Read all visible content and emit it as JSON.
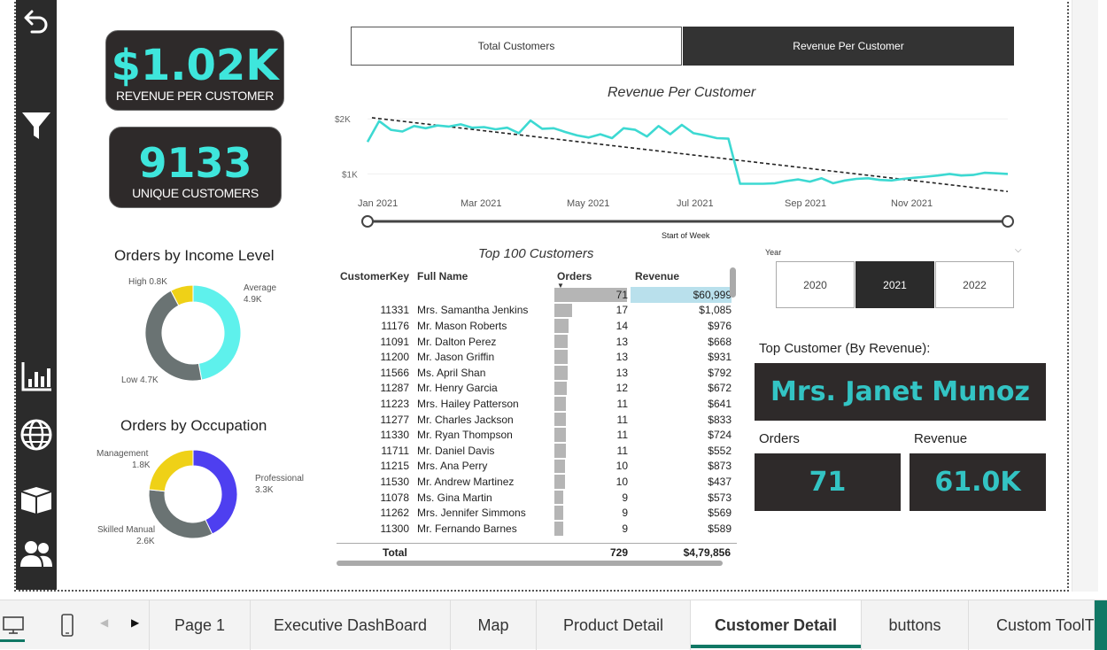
{
  "kpis": {
    "revenue_value": "$1.02K",
    "revenue_label": "REVENUE PER CUSTOMER",
    "customers_value": "9133",
    "customers_label": "UNIQUE CUSTOMERS"
  },
  "donut_income": {
    "title": "Orders by Income Level",
    "slices": [
      {
        "label": "Average",
        "value_label": "4.9K",
        "value": 4.9,
        "color": "#5ef1ec"
      },
      {
        "label": "Low",
        "value_label": "4.7K",
        "value": 4.7,
        "color": "#6a7373"
      },
      {
        "label": "High",
        "value_label": "0.8K",
        "value": 0.8,
        "color": "#efd117"
      }
    ],
    "label_high": "High 0.8K",
    "label_avg_name": "Average",
    "label_avg_val": "4.9K",
    "label_low": "Low 4.7K"
  },
  "donut_occupation": {
    "title": "Orders by Occupation",
    "slices": [
      {
        "label": "Professional",
        "value_label": "3.3K",
        "value": 3.3,
        "color": "#4e3ff0"
      },
      {
        "label": "Skilled Manual",
        "value_label": "2.6K",
        "value": 2.6,
        "color": "#6a7373"
      },
      {
        "label": "Management",
        "value_label": "1.8K",
        "value": 1.8,
        "color": "#efd117"
      }
    ],
    "label_mgmt_name": "Management",
    "label_mgmt_val": "1.8K",
    "label_prof_name": "Professional",
    "label_prof_val": "3.3K",
    "label_skill_name": "Skilled Manual",
    "label_skill_val": "2.6K"
  },
  "toggle": {
    "total_customers": "Total Customers",
    "revenue_per_customer": "Revenue Per Customer"
  },
  "chart_data": {
    "type": "line",
    "title": "Revenue Per Customer",
    "xlabel": "Start of Week",
    "ylabel": "",
    "y_ticks": [
      "$1K",
      "$2K"
    ],
    "x_ticks": [
      "Jan 2021",
      "Mar 2021",
      "May 2021",
      "Jul 2021",
      "Sep 2021",
      "Nov 2021"
    ],
    "ylim": [
      700,
      2100
    ],
    "series": [
      {
        "values": [
          1580,
          1960,
          1800,
          1770,
          1870,
          1830,
          1880,
          1860,
          1900,
          1840,
          1850,
          1810,
          1840,
          1740,
          1970,
          1820,
          1830,
          1760,
          1700,
          1660,
          1720,
          1650,
          1830,
          1800,
          1680,
          1870,
          1720,
          1890,
          1740,
          1700,
          1650,
          1640,
          820,
          820,
          820,
          830,
          870,
          900,
          860,
          920,
          830,
          880,
          910,
          920,
          890,
          880,
          910,
          930,
          950,
          970,
          1000,
          970,
          980,
          1020,
          1010,
          1000
        ]
      }
    ],
    "trendline": [
      2020,
      680
    ],
    "color": "#3dd9d2"
  },
  "table": {
    "title": "Top 100 Customers",
    "headers": [
      "CustomerKey",
      "Full Name",
      "Orders",
      "Revenue"
    ],
    "top_row": {
      "key": "",
      "name": "",
      "orders": "71",
      "revenue": "$60,999"
    },
    "rows": [
      {
        "key": "11331",
        "name": "Mrs. Samantha Jenkins",
        "orders": "17",
        "revenue": "$1,085"
      },
      {
        "key": "11176",
        "name": "Mr. Mason Roberts",
        "orders": "14",
        "revenue": "$976"
      },
      {
        "key": "11091",
        "name": "Mr. Dalton Perez",
        "orders": "13",
        "revenue": "$668"
      },
      {
        "key": "11200",
        "name": "Mr. Jason Griffin",
        "orders": "13",
        "revenue": "$931"
      },
      {
        "key": "11566",
        "name": "Ms. April Shan",
        "orders": "13",
        "revenue": "$792"
      },
      {
        "key": "11287",
        "name": "Mr. Henry Garcia",
        "orders": "12",
        "revenue": "$672"
      },
      {
        "key": "11223",
        "name": "Mrs. Hailey Patterson",
        "orders": "11",
        "revenue": "$641"
      },
      {
        "key": "11277",
        "name": "Mr. Charles Jackson",
        "orders": "11",
        "revenue": "$833"
      },
      {
        "key": "11330",
        "name": "Mr. Ryan Thompson",
        "orders": "11",
        "revenue": "$724"
      },
      {
        "key": "11711",
        "name": "Mr. Daniel Davis",
        "orders": "11",
        "revenue": "$552"
      },
      {
        "key": "11215",
        "name": "Mrs. Ana Perry",
        "orders": "10",
        "revenue": "$873"
      },
      {
        "key": "11530",
        "name": "Mr. Andrew Martinez",
        "orders": "10",
        "revenue": "$437"
      },
      {
        "key": "11078",
        "name": "Ms. Gina Martin",
        "orders": "9",
        "revenue": "$573"
      },
      {
        "key": "11262",
        "name": "Mrs. Jennifer Simmons",
        "orders": "9",
        "revenue": "$569"
      },
      {
        "key": "11300",
        "name": "Mr. Fernando Barnes",
        "orders": "9",
        "revenue": "$589"
      }
    ],
    "total_label": "Total",
    "total_orders": "729",
    "total_revenue": "$4,79,856"
  },
  "year_slicer": {
    "label": "Year",
    "options": [
      "2020",
      "2021",
      "2022"
    ],
    "selected": "2021"
  },
  "top_customer": {
    "label": "Top Customer (By Revenue):",
    "name": "Mrs. Janet Munoz",
    "orders_label": "Orders",
    "revenue_label": "Revenue",
    "orders_value": "71",
    "revenue_value": "61.0K"
  },
  "page_tabs": [
    "Page 1",
    "Executive DashBoard",
    "Map",
    "Product Detail",
    "Customer Detail",
    "buttons",
    "Custom ToolTi"
  ],
  "active_tab": "Customer Detail"
}
